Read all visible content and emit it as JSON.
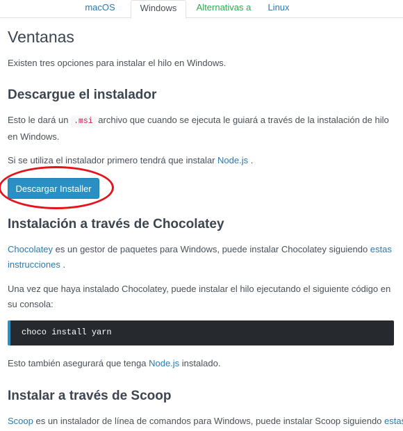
{
  "tabs": [
    {
      "label": "macOS"
    },
    {
      "label": "Windows"
    },
    {
      "label": "Alternativas a"
    },
    {
      "label": "Linux"
    }
  ],
  "page_title": "Ventanas",
  "intro": "Existen tres opciones para instalar el hilo en Windows.",
  "installer": {
    "heading": "Descargue el instalador",
    "p1_before": "Esto le dará un ",
    "p1_code": ".msi",
    "p1_after": " archivo que cuando se ejecuta le guiará a través de la instalación de hilo en Windows.",
    "p2_before": "Si se utiliza el instalador primero tendrá que instalar ",
    "p2_link": "Node.js",
    "p2_after": " .",
    "button_label": "Descargar Installer"
  },
  "chocolatey": {
    "heading": "Instalación a través de Chocolatey",
    "p1_link": "Chocolatey",
    "p1_mid": " es un gestor de paquetes para Windows, puede instalar Chocolatey siguiendo ",
    "p1_link2": "estas instrucciones",
    "p1_after": " .",
    "p2": "Una vez que haya instalado Chocolatey, puede instalar el hilo ejecutando el siguiente código en su consola:",
    "code": "choco install yarn",
    "p3_before": "Esto también asegurará que tenga ",
    "p3_link": "Node.js",
    "p3_after": " instalado."
  },
  "scoop": {
    "heading": "Instalar a través de Scoop",
    "p1_link": "Scoop",
    "p1_mid": " es un instalador de línea de comandos para Windows, puede instalar Scoop siguiendo ",
    "p1_link2": "estas"
  },
  "colors": {
    "link": "#2a7ab0",
    "button": "#2a8fc2",
    "highlight_circle": "#e3141b",
    "code_bg": "#262a2f"
  }
}
